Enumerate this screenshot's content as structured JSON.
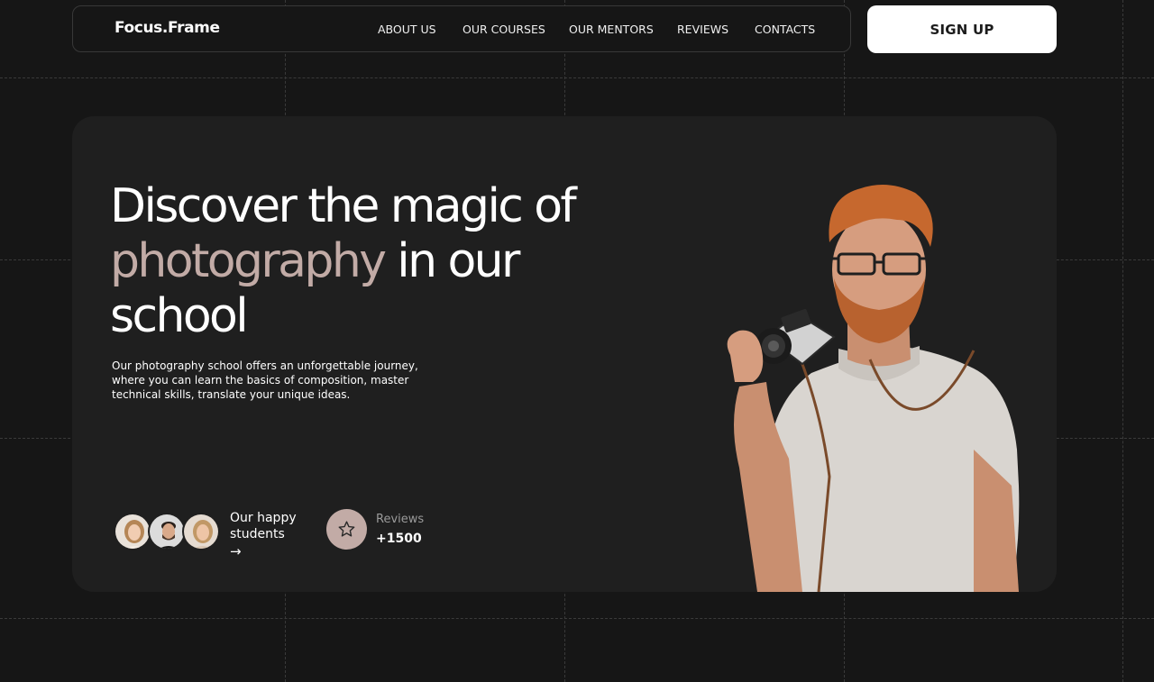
{
  "header": {
    "logo": "Focus.Frame",
    "nav": [
      {
        "label": "ABOUT US"
      },
      {
        "label": "OUR COURSES"
      },
      {
        "label": "OUR MENTORS"
      },
      {
        "label": "REVIEWS"
      },
      {
        "label": "CONTACTS"
      }
    ],
    "signup_label": "SIGN UP"
  },
  "hero": {
    "title_line1": "Discover the magic of",
    "title_accent": "photography",
    "title_line2_rest": " in our",
    "title_line3": "school",
    "description": "Our photography school offers an unforgettable journey, where you can learn the basics of composition, master technical skills, translate your unique ideas.",
    "students_label": "Our happy students",
    "arrow": "→",
    "reviews_label": "Reviews",
    "reviews_count": "+1500"
  },
  "colors": {
    "background": "#161616",
    "card": "#1f1f1f",
    "accent": "#c2aba6",
    "button": "#ffffff"
  },
  "icons": {
    "arrow": "arrow-right-icon",
    "star": "star-icon"
  }
}
